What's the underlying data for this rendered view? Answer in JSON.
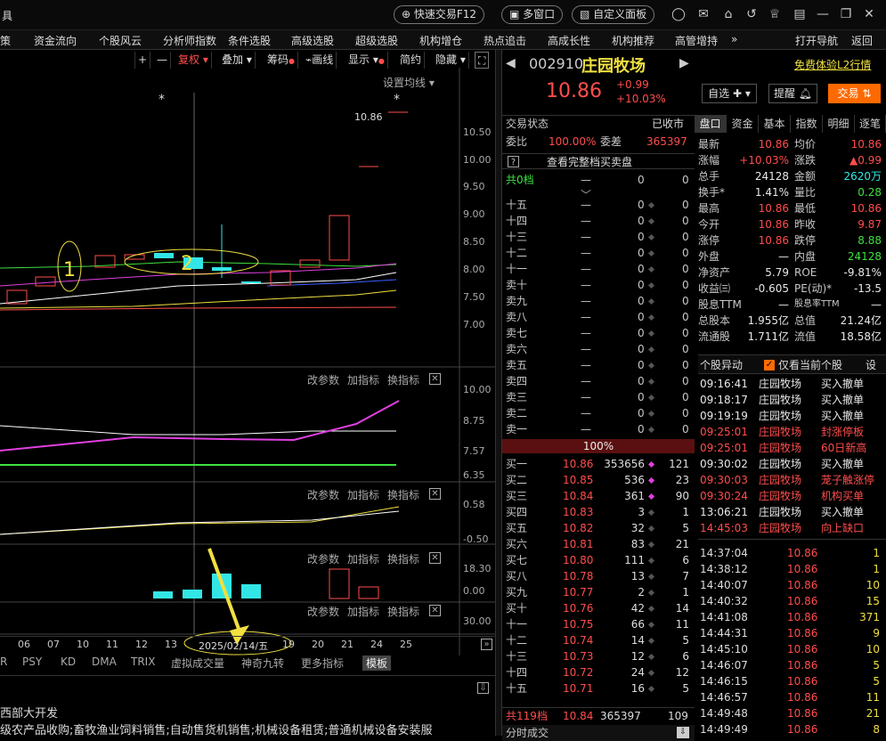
{
  "titlebar": {
    "btn_quick": "快速交易F12",
    "btn_multi": "多窗口",
    "btn_custom": "自定义面板",
    "left_frag": "具"
  },
  "menu": [
    "策",
    "资金流向",
    "个股风云",
    "分析师指数",
    "条件选股",
    "高级选股",
    "超级选股",
    "机构增仓",
    "热点追击",
    "高成长性",
    "机构推荐",
    "高管增持"
  ],
  "menu_more": "»",
  "menu_nav": "打开导航",
  "menu_back": "返回",
  "toolbar": {
    "plus": "+",
    "minus": "—",
    "fuquan": "复权",
    "overlay": "叠加",
    "chip": "筹码",
    "draw": "画线",
    "display": "显示",
    "simple": "简约",
    "hide": "隐藏",
    "setma": "设置均线"
  },
  "price_axis": [
    "10.50",
    "10.00",
    "9.50",
    "9.00",
    "8.50",
    "8.00",
    "7.50",
    "7.00"
  ],
  "last_price_label": "10.86",
  "ann": {
    "one": "1",
    "two": "2",
    "star": "*"
  },
  "panel_btns": {
    "param": "改参数",
    "add": "加指标",
    "switch": "换指标",
    "close": "✕"
  },
  "p2_axis": [
    "10.00",
    "8.75",
    "7.57",
    "6.35"
  ],
  "p3_axis": [
    "0.58",
    "-0.50"
  ],
  "p4_axis": [
    "18.30",
    "0.00"
  ],
  "p5_axis": [
    "30.00"
  ],
  "xaxis": [
    "06",
    "07",
    "10",
    "11",
    "12",
    "13",
    "2025/02/14/五",
    "19",
    "20",
    "21",
    "24",
    "25"
  ],
  "bottom_tabs": [
    "R",
    "PSY",
    "KD",
    "DMA",
    "TRIX",
    "虚拟成交量",
    "神奇九转",
    "更多指标",
    "模板"
  ],
  "bottom_text1": "西部大开发",
  "bottom_text2": "级农产品收购;畜牧渔业饲料销售;自动售货机销售;机械设备租赁;普通机械设备安装服",
  "stock": {
    "code": "002910",
    "name": "庄园牧场",
    "price": "10.86",
    "chg": "+0.99",
    "pct": "+10.03%",
    "free_l2": "免费体验L2行情",
    "watch": "自选",
    "alert": "提醒",
    "trade": "交易"
  },
  "state": {
    "label": "交易状态",
    "value": "已收市",
    "weibi_l": "委比",
    "weibi": "100.00%",
    "weicha_l": "委差",
    "weicha": "365397",
    "full": "查看完整档买卖盘",
    "q": "?",
    "gong0": "共0档",
    "z0a": "0",
    "z0b": "0",
    "pct100": "100%"
  },
  "sells": [
    [
      "十五",
      "—",
      "0",
      "0"
    ],
    [
      "十四",
      "—",
      "0",
      "0"
    ],
    [
      "十三",
      "—",
      "0",
      "0"
    ],
    [
      "十二",
      "—",
      "0",
      "0"
    ],
    [
      "十一",
      "—",
      "0",
      "0"
    ],
    [
      "卖十",
      "—",
      "0",
      "0"
    ],
    [
      "卖九",
      "—",
      "0",
      "0"
    ],
    [
      "卖八",
      "—",
      "0",
      "0"
    ],
    [
      "卖七",
      "—",
      "0",
      "0"
    ],
    [
      "卖六",
      "—",
      "0",
      "0"
    ],
    [
      "卖五",
      "—",
      "0",
      "0"
    ],
    [
      "卖四",
      "—",
      "0",
      "0"
    ],
    [
      "卖三",
      "—",
      "0",
      "0"
    ],
    [
      "卖二",
      "—",
      "0",
      "0"
    ],
    [
      "卖一",
      "—",
      "0",
      "0"
    ]
  ],
  "buys": [
    [
      "买一",
      "10.86",
      "353656",
      "121"
    ],
    [
      "买二",
      "10.85",
      "536",
      "23"
    ],
    [
      "买三",
      "10.84",
      "361",
      "90"
    ],
    [
      "买四",
      "10.83",
      "3",
      "1"
    ],
    [
      "买五",
      "10.82",
      "32",
      "5"
    ],
    [
      "买六",
      "10.81",
      "83",
      "21"
    ],
    [
      "买七",
      "10.80",
      "111",
      "6"
    ],
    [
      "买八",
      "10.78",
      "13",
      "7"
    ],
    [
      "买九",
      "10.77",
      "2",
      "1"
    ],
    [
      "买十",
      "10.76",
      "42",
      "14"
    ],
    [
      "十一",
      "10.75",
      "66",
      "11"
    ],
    [
      "十二",
      "10.74",
      "14",
      "5"
    ],
    [
      "十三",
      "10.73",
      "12",
      "6"
    ],
    [
      "十四",
      "10.72",
      "24",
      "12"
    ],
    [
      "十五",
      "10.71",
      "16",
      "5"
    ]
  ],
  "buy_total": {
    "label": "共119档",
    "price": "10.84",
    "vol": "365397",
    "n": "109"
  },
  "fenshi": "分时成交",
  "tabs": [
    "盘口",
    "资金",
    "基本",
    "指数",
    "明细",
    "逐笔"
  ],
  "quote": [
    [
      "最新",
      "10.86",
      "均价",
      "10.86"
    ],
    [
      "涨幅",
      "+10.03%",
      "涨跌",
      "▲0.99"
    ],
    [
      "总手",
      "24128",
      "金额",
      "2620万"
    ],
    [
      "换手*",
      "1.41%",
      "量比",
      "0.28"
    ],
    [
      "最高",
      "10.86",
      "最低",
      "10.86"
    ],
    [
      "今开",
      "10.86",
      "昨收",
      "9.87"
    ],
    [
      "涨停",
      "10.86",
      "跌停",
      "8.88"
    ],
    [
      "外盘",
      "—",
      "内盘",
      "24128"
    ],
    [
      "净资产",
      "5.79",
      "ROE",
      "-9.81%"
    ],
    [
      "收益㈢",
      "-0.605",
      "PE(动)*",
      "-13.5"
    ],
    [
      "股息TTM",
      "—",
      "股息率TTM",
      "—"
    ],
    [
      "总股本",
      "1.955亿",
      "总值",
      "21.24亿"
    ],
    [
      "流通股",
      "1.711亿",
      "流值",
      "18.58亿"
    ]
  ],
  "events_header": {
    "title": "个股异动",
    "only": "仅看当前个股",
    "set": "设"
  },
  "events": [
    [
      "09:16:41",
      "庄园牧场",
      "买入撤单"
    ],
    [
      "09:18:17",
      "庄园牧场",
      "买入撤单"
    ],
    [
      "09:19:19",
      "庄园牧场",
      "买入撤单"
    ],
    [
      "09:25:01",
      "庄园牧场",
      "封涨停板"
    ],
    [
      "09:25:01",
      "庄园牧场",
      "60日新高"
    ],
    [
      "09:30:02",
      "庄园牧场",
      "买入撤单"
    ],
    [
      "09:30:03",
      "庄园牧场",
      "茏子触涨停"
    ],
    [
      "09:30:24",
      "庄园牧场",
      "机构买单"
    ],
    [
      "13:06:21",
      "庄园牧场",
      "买入撤单"
    ],
    [
      "14:45:03",
      "庄园牧场",
      "向上缺口"
    ]
  ],
  "ticks": [
    [
      "14:37:04",
      "10.86",
      "1"
    ],
    [
      "14:38:12",
      "10.86",
      "1"
    ],
    [
      "14:40:07",
      "10.86",
      "10"
    ],
    [
      "14:40:32",
      "10.86",
      "15"
    ],
    [
      "14:41:08",
      "10.86",
      "371"
    ],
    [
      "14:44:31",
      "10.86",
      "9"
    ],
    [
      "14:45:10",
      "10.86",
      "10"
    ],
    [
      "14:46:07",
      "10.86",
      "5"
    ],
    [
      "14:46:15",
      "10.86",
      "5"
    ],
    [
      "14:46:57",
      "10.86",
      "11"
    ],
    [
      "14:49:48",
      "10.86",
      "21"
    ],
    [
      "14:49:49",
      "10.86",
      "8"
    ]
  ],
  "colors": {
    "up": "#ff4d4d",
    "down": "#3fe03f",
    "cyan": "#33e6e6",
    "yellow": "#f0e040",
    "magenta": "#e040e0",
    "orange": "#ff6a00"
  }
}
